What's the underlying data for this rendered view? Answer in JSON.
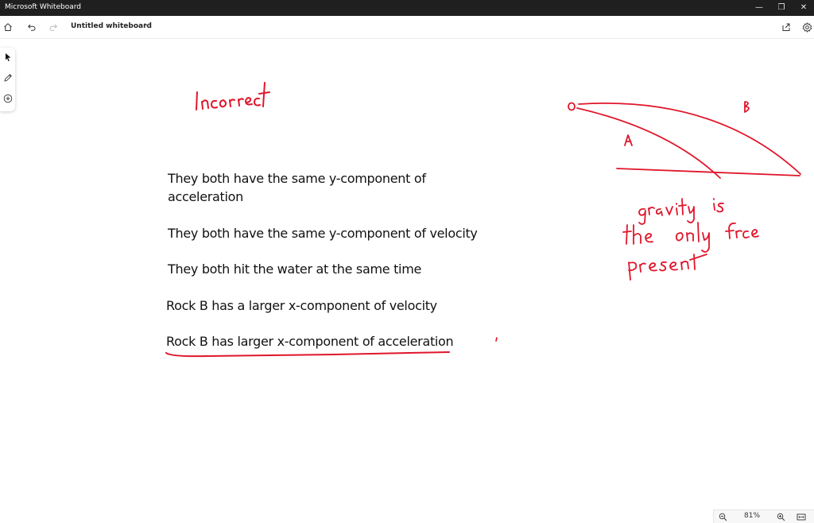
{
  "window": {
    "title": "Microsoft Whiteboard",
    "minimize_glyph": "—",
    "restore_glyph": "❐",
    "close_glyph": "✕"
  },
  "toolbar": {
    "board_name": "Untitled whiteboard",
    "icons": [
      "home-icon",
      "undo-icon",
      "redo-icon",
      "chevron-down-icon",
      "share-icon",
      "settings-icon"
    ]
  },
  "tools": [
    "select-pointer-icon",
    "pen-icon",
    "add-icon"
  ],
  "canvas": {
    "handwritten_title": "Incorrect",
    "statements": [
      "They both have the same y-component of",
      "acceleration",
      "They both have the same y-component of velocity",
      "They both hit the water at the same time",
      "Rock B has a larger x-component of velocity",
      "Rock B has larger x-component of acceleration"
    ],
    "diagram_labels": {
      "origin": "O",
      "path_a": "A",
      "path_b": "B"
    },
    "note_lines": [
      "gravity is",
      "the only force",
      "present"
    ],
    "ink_color": "#e0162b"
  },
  "zoom": {
    "level": "81%"
  }
}
